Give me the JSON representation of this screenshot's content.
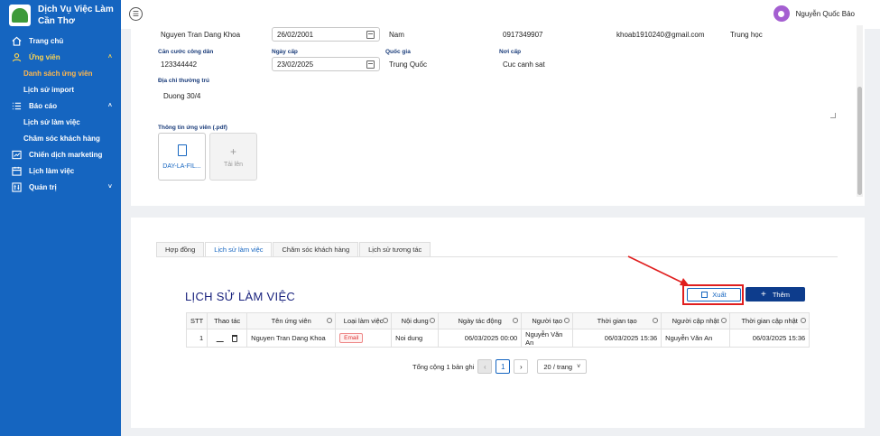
{
  "sidebar": {
    "brand": [
      "Dịch Vụ Việc Làm",
      "Cần Thơ"
    ],
    "items": [
      {
        "label": "Trang chủ",
        "icon": "home-icon"
      },
      {
        "label": "Ứng viên",
        "icon": "users-icon",
        "chevron": "˄"
      },
      {
        "label": "Báo cáo",
        "icon": "list-icon",
        "chevron": "˄"
      },
      {
        "label": "Chiến dịch marketing",
        "icon": "chart-icon"
      },
      {
        "label": "Lịch làm việc",
        "icon": "calendar-icon"
      },
      {
        "label": "Quản trị",
        "icon": "admin-icon",
        "chevron": "˅"
      }
    ],
    "ung_vien_sub": [
      "Danh sách ứng viên",
      "Lịch sử import"
    ],
    "bao_cao_sub": [
      "Lịch sử làm việc",
      "Chăm sóc khách hàng"
    ]
  },
  "header": {
    "menu_toggle": "☰",
    "user_name": "Nguyễn Quốc Bảo"
  },
  "form": {
    "name": "Nguyen Tran Dang Khoa",
    "birth_date": "26/02/2001",
    "gender": "Nam",
    "phone": "0917349907",
    "email": "khoab1910240@gmail.com",
    "education": "Trung học",
    "id_card_label": "Căn cước công dân",
    "id_card": "123344442",
    "issue_date_label": "Ngày cấp",
    "issue_date": "23/02/2025",
    "country_label": "Quốc gia",
    "country": "Trung Quốc",
    "issue_place_label": "Nơi cấp",
    "issue_place": "Cuc canh sat",
    "address_label": "Địa chỉ thường trú",
    "address": "Duong 30/4",
    "pdf_label": "Thông tin ứng viên (.pdf)",
    "file_name": "DAY-LA-FIL...",
    "upload_label": "Tải lên",
    "upload_plus": "+"
  },
  "tabs": [
    "Hợp đồng",
    "Lịch sử làm việc",
    "Chăm sóc khách hàng",
    "Lịch sử tương tác"
  ],
  "section": {
    "title": "LỊCH SỬ LÀM VIỆC",
    "export_label": "Xuất",
    "add_label": "Thêm",
    "add_plus": "+"
  },
  "table": {
    "headers": [
      "STT",
      "Thao tác",
      "Tên ứng viên",
      "Loại làm việc",
      "Nội dung",
      "Ngày tác động",
      "Người tạo",
      "Thời gian tạo",
      "Người cập nhật",
      "Thời gian cập nhật"
    ],
    "rows": [
      {
        "stt": "1",
        "name": "Nguyen Tran Dang Khoa",
        "type": "Email",
        "content": "Noi dung",
        "action_date": "06/03/2025 00:00",
        "creator": "Nguyễn Văn An",
        "created_at": "06/03/2025 15:36",
        "updater": "Nguyễn Văn An",
        "updated_at": "06/03/2025 15:36"
      }
    ]
  },
  "pagination": {
    "total": "Tổng cộng 1 bản ghi",
    "prev": "‹",
    "current": "1",
    "next": "›",
    "page_size": "20 / trang",
    "dropdown": "˅"
  },
  "colors": {
    "sidebar": "#1565c0",
    "accent": "#0d3c8c",
    "highlight": "#e01e1e"
  }
}
